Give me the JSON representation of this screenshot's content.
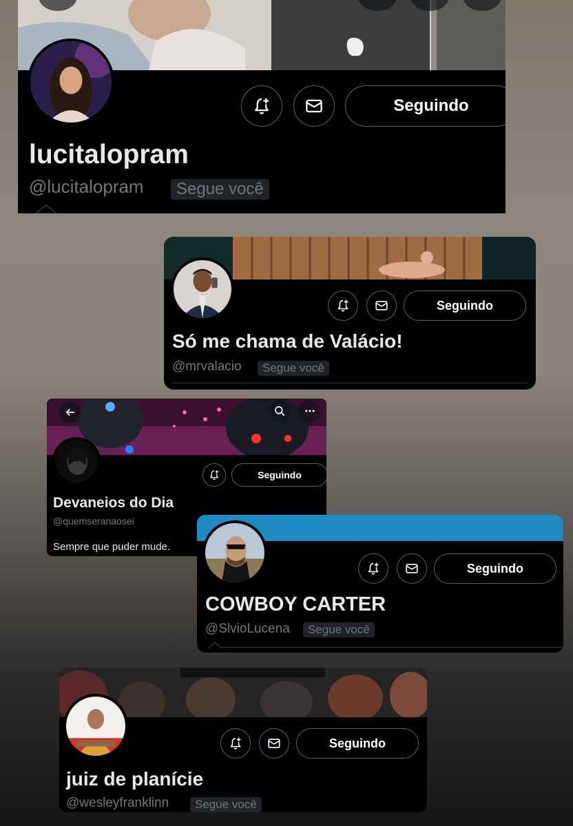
{
  "profiles": [
    {
      "name": "lucitalopram",
      "handle": "@lucitalopram",
      "follows_you": "Segue você",
      "following_label": "Seguindo"
    },
    {
      "name": "Só me chama de Valácio!",
      "handle": "@mrvalacio",
      "follows_you": "Segue você",
      "following_label": "Seguindo"
    },
    {
      "name": "Devaneios do Dia",
      "handle": "@quemseranaosei",
      "bio": "Sempre que puder mude.",
      "following_label": "Seguindo"
    },
    {
      "name": "COWBOY CARTER",
      "handle": "@SlvioLucena",
      "follows_you": "Segue você",
      "following_label": "Seguindo"
    },
    {
      "name": "juiz de planície",
      "handle": "@wesleyfranklinn",
      "follows_you": "Segue você",
      "following_label": "Seguindo"
    }
  ],
  "icons": {
    "notify": "bell-plus-icon",
    "message": "envelope-icon",
    "back": "arrow-left-icon",
    "search": "search-icon",
    "more": "more-icon"
  },
  "colors": {
    "card_bg": "#000000",
    "muted_text": "#71767b",
    "border": "#536471",
    "cowboy_banner": "#1d8bc1"
  }
}
